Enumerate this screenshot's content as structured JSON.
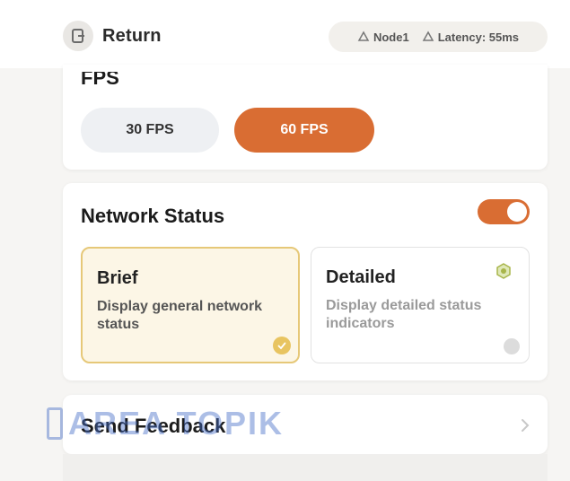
{
  "header": {
    "return_label": "Return",
    "status": {
      "node_label": "Node1",
      "latency_label": "Latency: 55ms"
    }
  },
  "fps": {
    "title": "FPS",
    "options": [
      "30 FPS",
      "60 FPS"
    ],
    "selected": "60 FPS"
  },
  "network_status": {
    "title": "Network Status",
    "toggle_on": true,
    "options": [
      {
        "title": "Brief",
        "description": "Display general network status",
        "selected": true
      },
      {
        "title": "Detailed",
        "description": "Display detailed status indicators",
        "selected": false
      }
    ]
  },
  "feedback": {
    "label": "Send Feedback"
  },
  "watermark": {
    "text": "AREA TOPIK"
  },
  "colors": {
    "accent": "#d96d33",
    "selected_bg": "#fcf6e6",
    "selected_border": "#e6c878",
    "check_badge": "#e8c460"
  }
}
